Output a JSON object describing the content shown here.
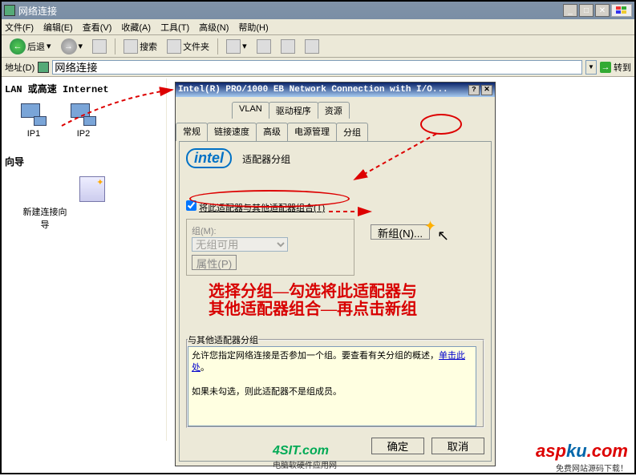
{
  "window": {
    "title": "网络连接",
    "menu": {
      "file": "文件(F)",
      "edit": "编辑(E)",
      "view": "查看(V)",
      "fav": "收藏(A)",
      "tools": "工具(T)",
      "adv": "高级(N)",
      "help": "帮助(H)"
    },
    "toolbar": {
      "back": "后退",
      "search": "搜索",
      "folders": "文件夹"
    },
    "address_label": "地址(D)",
    "address_value": "网络连接",
    "go": "转到"
  },
  "left": {
    "lan_header": "LAN 或高速 Internet",
    "ip1": "IP1",
    "ip2": "IP2",
    "guide_header": "向导",
    "wizard": "新建连接向导"
  },
  "dialog": {
    "title": "Intel(R) PRO/1000 EB Network Connection with I/O...",
    "tabs_row1": {
      "vlan": "VLAN",
      "driver": "驱动程序",
      "resource": "资源"
    },
    "tabs_row2": {
      "general": "常规",
      "linkspeed": "链接速度",
      "advanced": "高级",
      "power": "电源管理",
      "group": "分组"
    },
    "section_title": "适配器分组",
    "checkbox": "将此适配器与其他适配器组合(T)",
    "group_label": "组(M):",
    "combo": "无组可用",
    "newgroup": "新组(N)...",
    "properties": "属性(P)",
    "fieldset": "与其他适配器分组",
    "info_line1": "允许您指定网络连接是否参加一个组。要查看有关分组的概述，",
    "info_link": "单击此处",
    "info_period": "。",
    "info_line2": "如果未勾选，则此适配器不是组成员。",
    "ok": "确定",
    "cancel": "取消"
  },
  "annotation": {
    "hint1": "选择分组—勾选将此适配器与",
    "hint2": "其他适配器组合—再点击新组"
  },
  "footer": {
    "brand1": "4SIT.com",
    "brand1_sub": "电脑软硬件应用网",
    "brand2a": "asp",
    "brand2b": "ku",
    "brand2c": ".com",
    "brand2_sub": "免费网站源码下载！"
  }
}
